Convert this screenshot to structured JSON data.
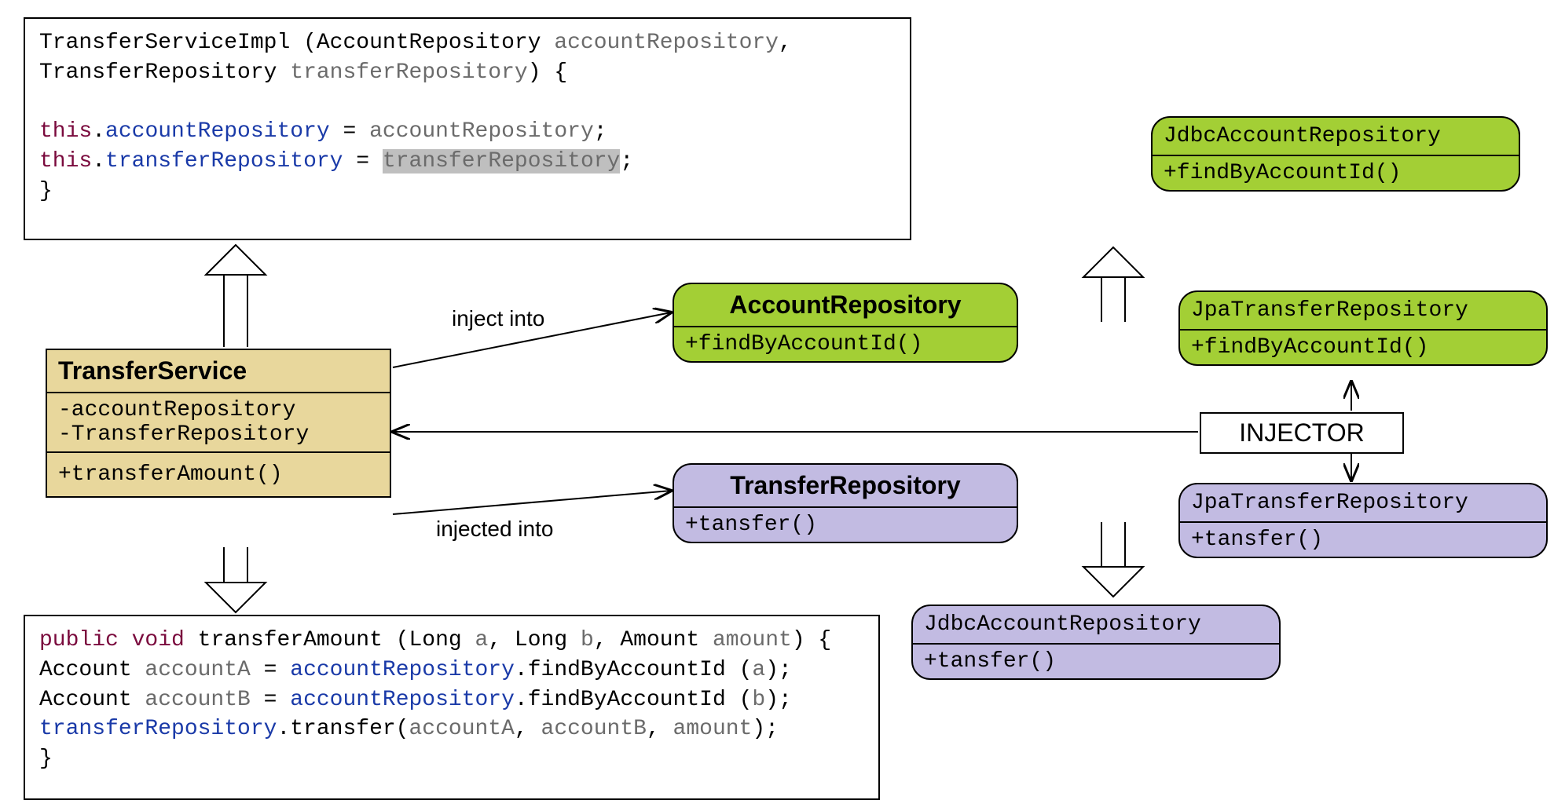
{
  "codeTop": {
    "tokens": {
      "ctor": "TransferServiceImpl",
      "lp": " (",
      "t_ar": "AccountRepository ",
      "p_ar": "accountRepository",
      "comma1": ",",
      "nl": " ",
      "t_tr": "TransferRepository ",
      "p_tr": "transferRepository",
      "rp": ") {",
      "this1": "this",
      "dot1": ".",
      "ref_ar": "accountRepository",
      "eq1": " = ",
      "rhs_ar": "accountRepository",
      "semi1": ";",
      "this2": "this",
      "dot2": ".",
      "ref_tr": "transferRepository",
      "eq2": " = ",
      "rhs_tr": "transferRepository",
      "semi2": ";",
      "close": "}"
    }
  },
  "codeBottom": {
    "tokens": {
      "kw_public": "public ",
      "kw_void": "void ",
      "fn": "transferAmount",
      "sig1": " (Long ",
      "pa": "a",
      "sig2": ", Long ",
      "pb": "b",
      "sig3": ", Amount ",
      "pamt": "amount",
      "sig4": ") {",
      "l2a": "Account ",
      "l2b": "accountA",
      "l2c": " = ",
      "l2d": "accountRepository",
      "l2e": ".findByAccountId (",
      "l2f": "a",
      "l2g": ");",
      "l3a": "Account ",
      "l3b": "accountB",
      "l3c": " = ",
      "l3d": "accountRepository",
      "l3e": ".findByAccountId (",
      "l3f": "b",
      "l3g": ");",
      "l4a": "transferRepository",
      "l4b": ".transfer(",
      "l4c": "accountA",
      "l4d": ", ",
      "l4e": "accountB",
      "l4f": ", ",
      "l4g": "amount",
      "l4h": ");",
      "close": "}"
    }
  },
  "transferService": {
    "title": "TransferService",
    "field1": "-accountRepository",
    "field2": "-TransferRepository",
    "method": "+transferAmount()"
  },
  "accountRepo": {
    "title": "AccountRepository",
    "method": "+findByAccountId()"
  },
  "transferRepo": {
    "title": "TransferRepository",
    "method": "+tansfer()"
  },
  "jdbcAccountRepo1": {
    "title": "JdbcAccountRepository",
    "method": "+findByAccountId()"
  },
  "jpaTransferRepo1": {
    "title": "JpaTransferRepository",
    "method": "+findByAccountId()"
  },
  "jpaTransferRepo2": {
    "title": "JpaTransferRepository",
    "method": "+tansfer()"
  },
  "jdbcAccountRepo2": {
    "title": "JdbcAccountRepository",
    "method": "+tansfer()"
  },
  "injector": "INJECTOR",
  "labels": {
    "injectInto": "inject into",
    "injectedInto": "injected into"
  }
}
